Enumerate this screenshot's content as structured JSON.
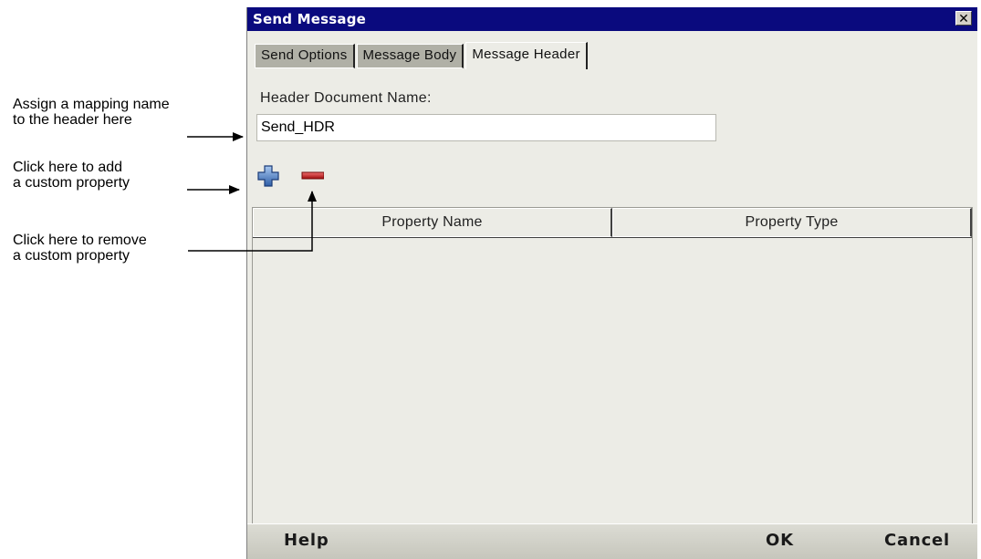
{
  "annotations": {
    "header_name": [
      "Assign a mapping name",
      "to the header here"
    ],
    "add_property": [
      "Click here to add",
      "a custom property"
    ],
    "remove_property": [
      "Click here to remove",
      "a custom property"
    ]
  },
  "dialog": {
    "title": "Send Message",
    "close_glyph": "✕",
    "tabs": [
      {
        "label": "Send Options",
        "active": false
      },
      {
        "label": "Message Body",
        "active": false
      },
      {
        "label": "Message Header",
        "active": true
      }
    ],
    "header_document_name": {
      "label": "Header Document Name:",
      "value": "Send_HDR"
    },
    "toolbar": {
      "add_icon": "plus-icon",
      "remove_icon": "minus-icon",
      "add_color": "#4a7fc8",
      "remove_color": "#c01818"
    },
    "table": {
      "columns": [
        "Property Name",
        "Property Type"
      ],
      "rows": []
    },
    "footer": {
      "help": "Help",
      "ok": "OK",
      "cancel": "Cancel"
    }
  },
  "colors": {
    "titlebar": "#0a0a7e",
    "dialog_bg": "#ecece6",
    "tab_inactive": "#b0b0a6"
  }
}
